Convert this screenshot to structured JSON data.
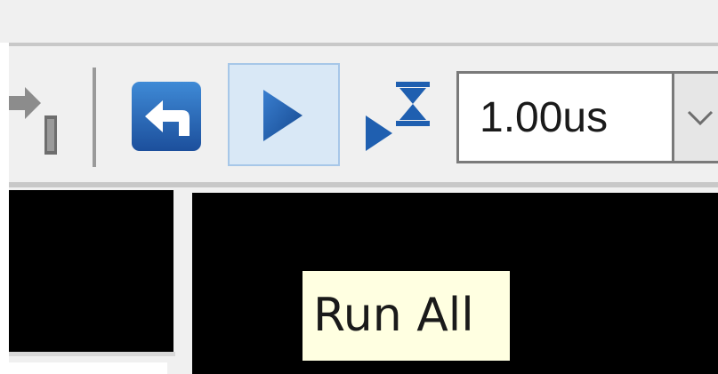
{
  "toolbar": {
    "icons": {
      "step": "step-over-icon",
      "restart": "restart-icon",
      "run_all": "run-all-icon",
      "run_for": "run-for-time-icon",
      "dropdown": "chevron-down-icon"
    },
    "run_time_value": "1.00us",
    "active_button": "run_all"
  },
  "tooltip": {
    "text": "Run All"
  },
  "colors": {
    "toolbar_bg": "#f0f0f0",
    "button_active_bg": "#d9e8f6",
    "button_active_border": "#a7c7e8",
    "icon_blue": "#1f5fb0",
    "tooltip_bg": "#ffffe1",
    "panel_bg": "#000000"
  }
}
